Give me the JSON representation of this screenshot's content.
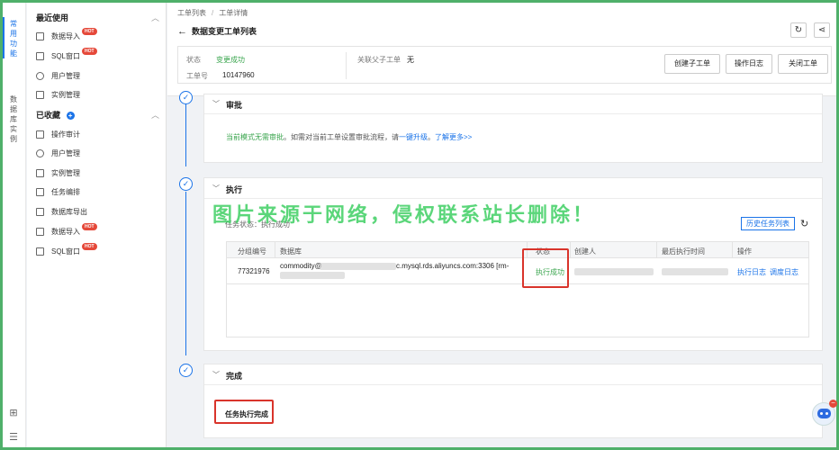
{
  "rail": {
    "items": [
      {
        "label": "常用功能",
        "active": true
      },
      {
        "label": "数据库实例",
        "active": false
      }
    ],
    "bottom_icons": [
      "grid-icon",
      "collapse-menu-icon"
    ]
  },
  "menu": {
    "recent": {
      "title": "最近使用",
      "items": [
        {
          "label": "数据导入",
          "icon": "import-icon",
          "hot": "HOT"
        },
        {
          "label": "SQL窗口",
          "icon": "sql-window-icon",
          "hot": "HOT"
        },
        {
          "label": "用户管理",
          "icon": "user-icon",
          "hot": ""
        },
        {
          "label": "实例管理",
          "icon": "instance-icon",
          "hot": ""
        }
      ]
    },
    "favorites": {
      "title": "已收藏",
      "items": [
        {
          "label": "操作审计",
          "icon": "audit-icon",
          "hot": ""
        },
        {
          "label": "用户管理",
          "icon": "user-icon",
          "hot": ""
        },
        {
          "label": "实例管理",
          "icon": "instance-icon",
          "hot": ""
        },
        {
          "label": "任务编排",
          "icon": "workflow-icon",
          "hot": ""
        },
        {
          "label": "数据库导出",
          "icon": "export-icon",
          "hot": ""
        },
        {
          "label": "数据导入",
          "icon": "import-icon",
          "hot": "HOT"
        },
        {
          "label": "SQL窗口",
          "icon": "sql-window-icon",
          "hot": "HOT"
        }
      ]
    }
  },
  "header": {
    "breadcrumb": [
      "工单列表",
      "工单详情"
    ],
    "separator": "/",
    "title": "数据变更工单列表",
    "info": {
      "status_label": "状态",
      "status_value": "变更成功",
      "ticket_label": "工单号",
      "ticket_value": "10147960",
      "parent_label": "关联父子工单",
      "parent_value": "无"
    },
    "buttons": [
      "创建子工单",
      "操作日志",
      "关闭工单"
    ]
  },
  "approve": {
    "title": "审批",
    "text_green": "当前模式无需审批",
    "text_mid": "。如需对当前工单设置审批流程，请",
    "link1": "一键升级",
    "text_dot": "。",
    "link2": "了解更多>>"
  },
  "execute": {
    "title": "执行",
    "status_text": "任务状态：执行成功",
    "history_button": "历史任务列表",
    "columns": [
      "分组编号",
      "数据库",
      "状态",
      "创建人",
      "最后执行时间",
      "操作"
    ],
    "row": {
      "group_id": "77321976",
      "db_prefix": "commodity@",
      "db_suffix": "c.mysql.rds.aliyuncs.com:3306 [rm-",
      "status": "执行成功",
      "action_1": "执行日志",
      "action_2": "调度日志"
    }
  },
  "complete": {
    "title": "完成",
    "text": "任务执行完成"
  },
  "watermark": "图片来源于网络，侵权联系站长删除！",
  "colors": {
    "accent": "#1a73e8",
    "success": "#3aa54e",
    "highlight": "#d9342b",
    "frame": "#4fb06a"
  }
}
